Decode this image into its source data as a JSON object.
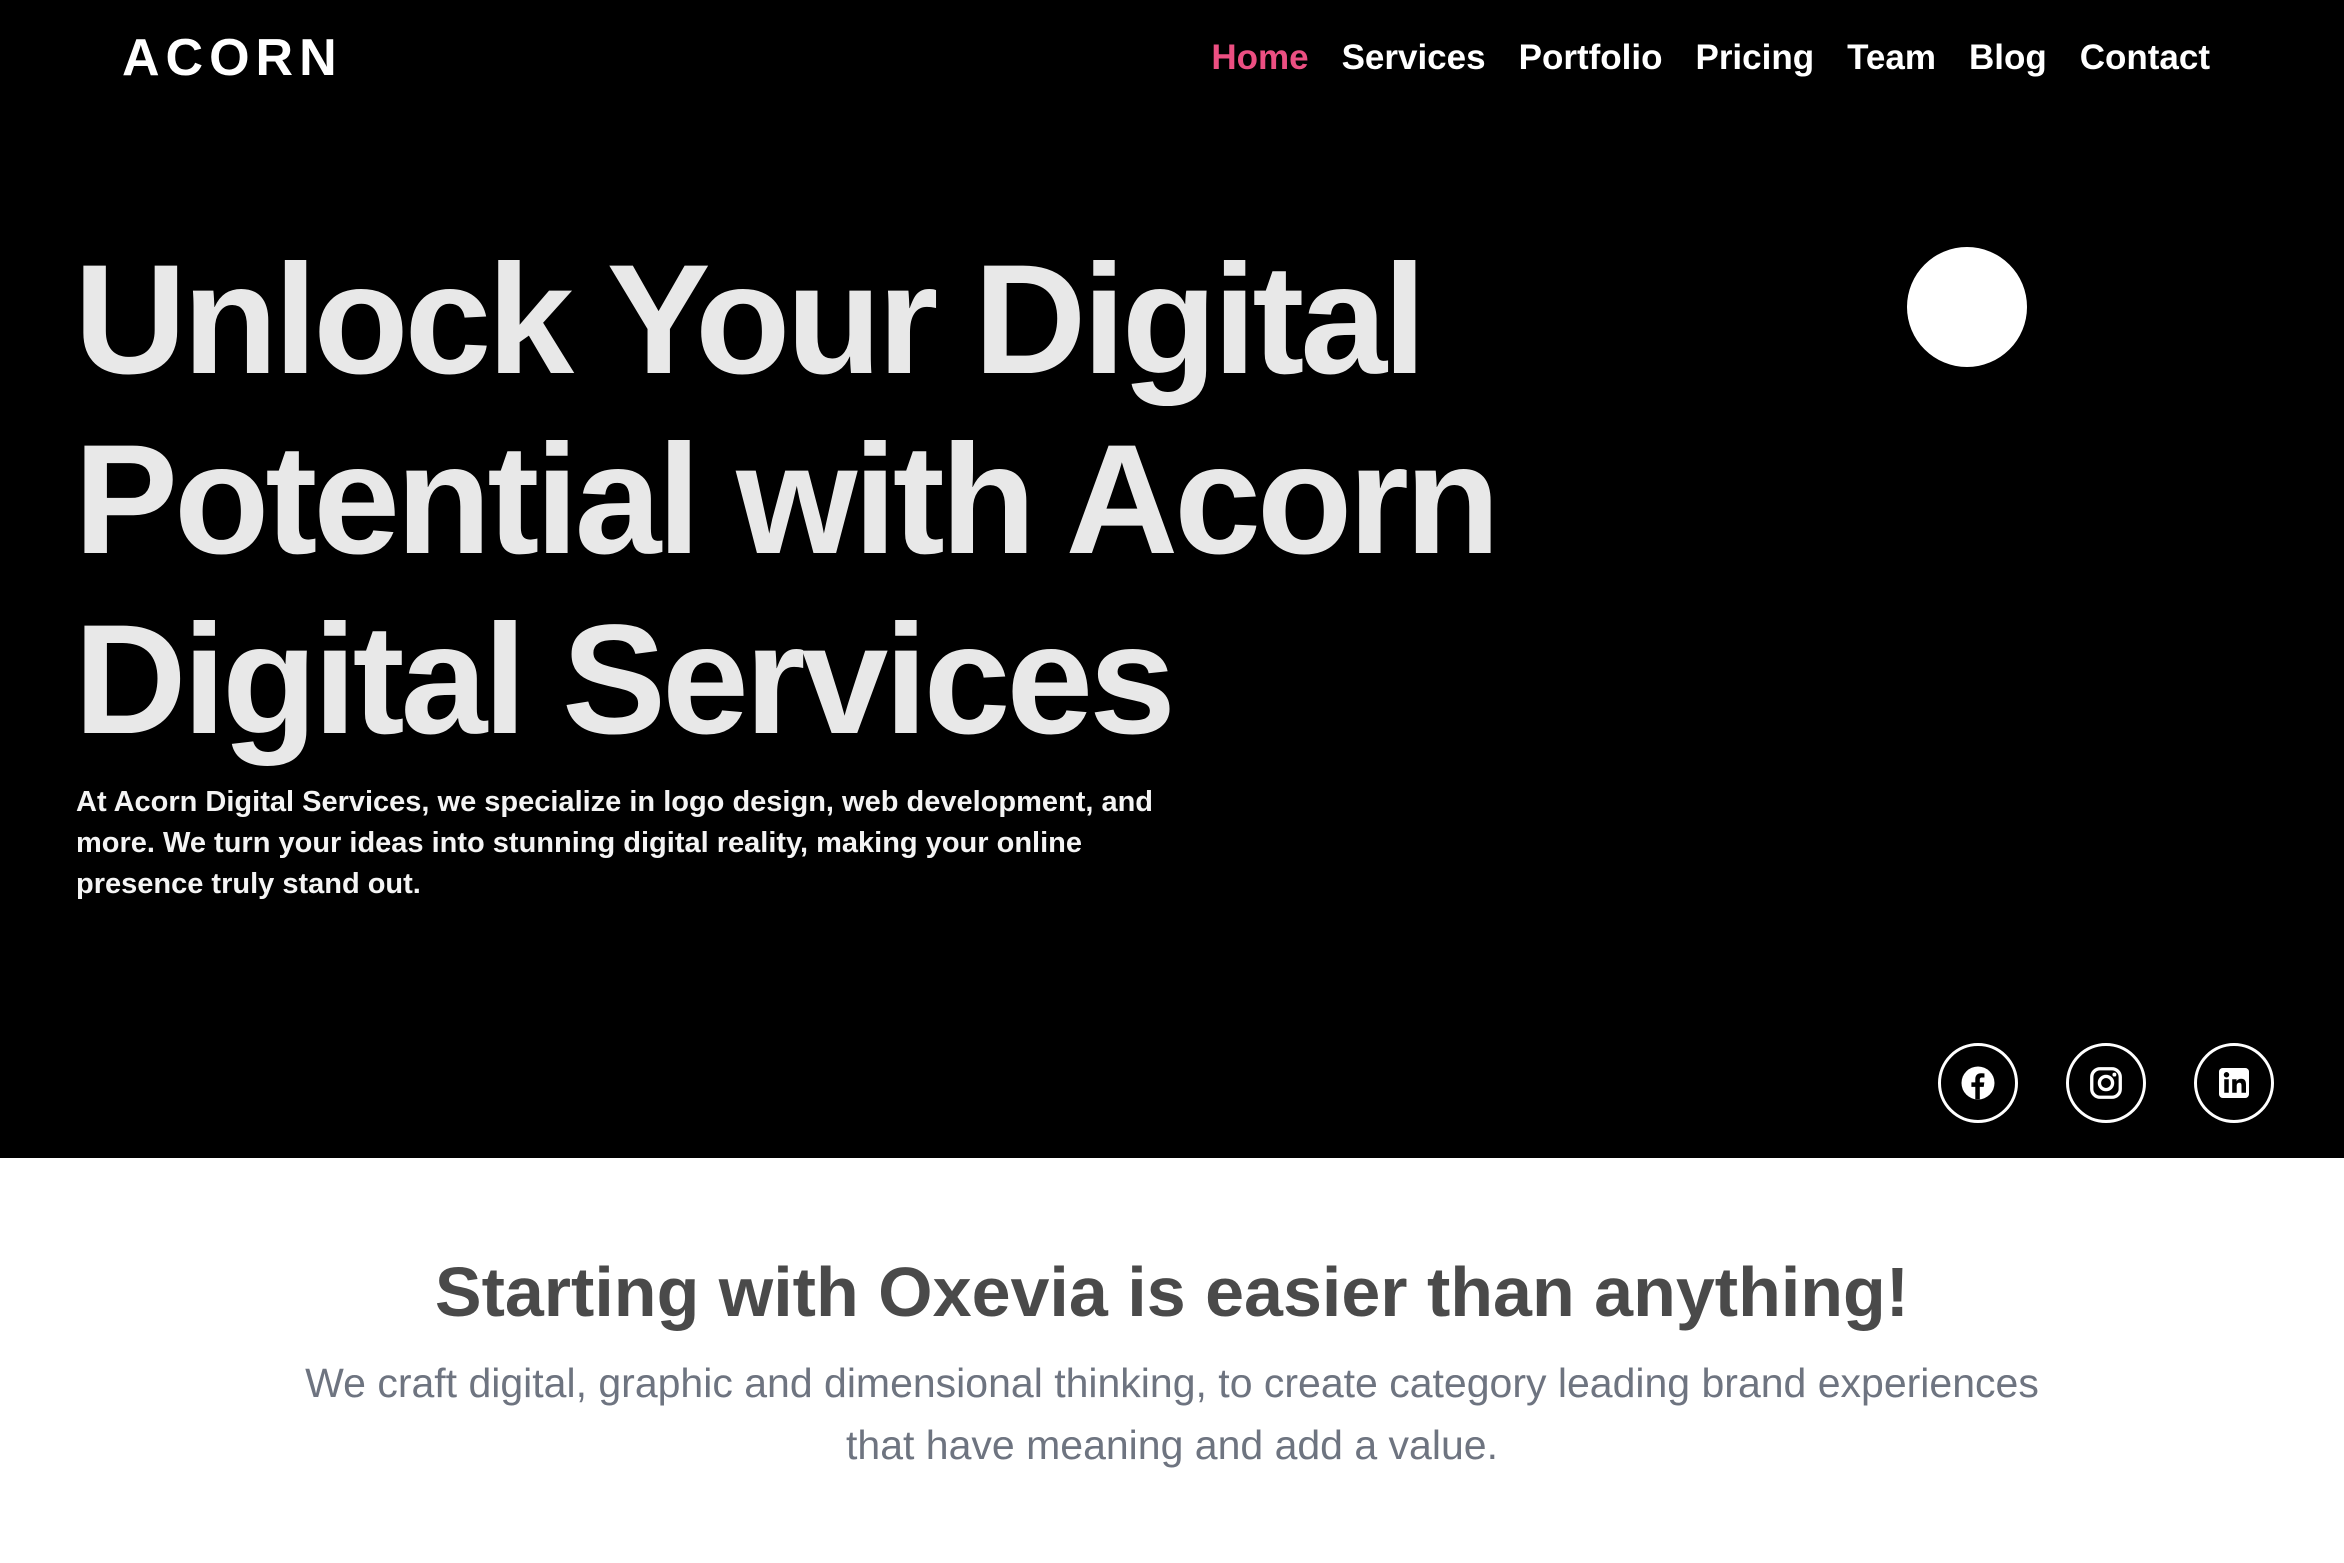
{
  "header": {
    "logo": "ACORN",
    "nav": [
      {
        "label": "Home",
        "active": true
      },
      {
        "label": "Services",
        "active": false
      },
      {
        "label": "Portfolio",
        "active": false
      },
      {
        "label": "Pricing",
        "active": false
      },
      {
        "label": "Team",
        "active": false
      },
      {
        "label": "Blog",
        "active": false
      },
      {
        "label": "Contact",
        "active": false
      }
    ]
  },
  "hero": {
    "headline": "Unlock Your Digital Potential with Acorn Digital Services",
    "description": "At Acorn Digital Services, we specialize in logo design, web development, and more. We turn your ideas into stunning digital reality, making your online presence truly stand out.",
    "social": [
      {
        "icon": "facebook-icon"
      },
      {
        "icon": "instagram-icon"
      },
      {
        "icon": "linkedin-icon"
      }
    ]
  },
  "intro": {
    "title": "Starting with Oxevia is easier than anything!",
    "text": "We craft digital, graphic and dimensional thinking, to create category leading brand experiences that have meaning and add a value."
  },
  "colors": {
    "background_dark": "#000000",
    "accent": "#ec4f82",
    "headline": "#e8e8e8",
    "intro_title": "#4a4a4a",
    "intro_text": "#6e7480"
  }
}
